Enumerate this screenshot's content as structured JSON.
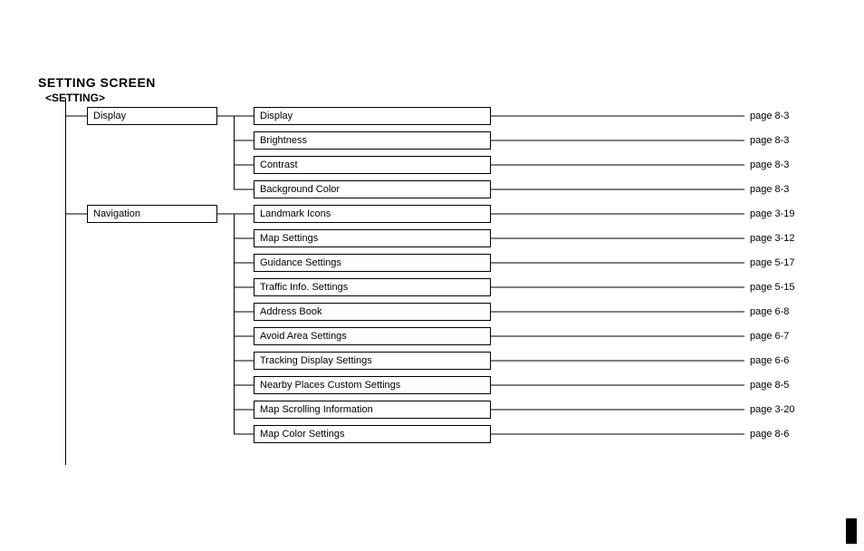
{
  "title": "SETTING SCREEN",
  "subtitle": "<SETTING>",
  "level1": {
    "display": "Display",
    "navigation": "Navigation"
  },
  "level2": {
    "display": "Display",
    "brightness": "Brightness",
    "contrast": "Contrast",
    "background_color": "Background Color",
    "landmark_icons": "Landmark Icons",
    "map_settings": "Map Settings",
    "guidance_settings": "Guidance Settings",
    "traffic_info_settings": "Traffic Info. Settings",
    "address_book": "Address Book",
    "avoid_area_settings": "Avoid Area Settings",
    "tracking_display_settings": "Tracking Display Settings",
    "nearby_places_custom_settings": "Nearby Places Custom Settings",
    "map_scrolling_information": "Map Scrolling Information",
    "map_color_settings": "Map Color Settings"
  },
  "pages": {
    "display": "page 8-3",
    "brightness": "page 8-3",
    "contrast": "page 8-3",
    "background_color": "page 8-3",
    "landmark_icons": "page 3-19",
    "map_settings": "page 3-12",
    "guidance_settings": "page 5-17",
    "traffic_info_settings": "page 5-15",
    "address_book": "page 6-8",
    "avoid_area_settings": "page 6-7",
    "tracking_display_settings": "page 6-6",
    "nearby_places_custom_settings": "page 8-5",
    "map_scrolling_information": "page 3-20",
    "map_color_settings": "page 8-6"
  }
}
